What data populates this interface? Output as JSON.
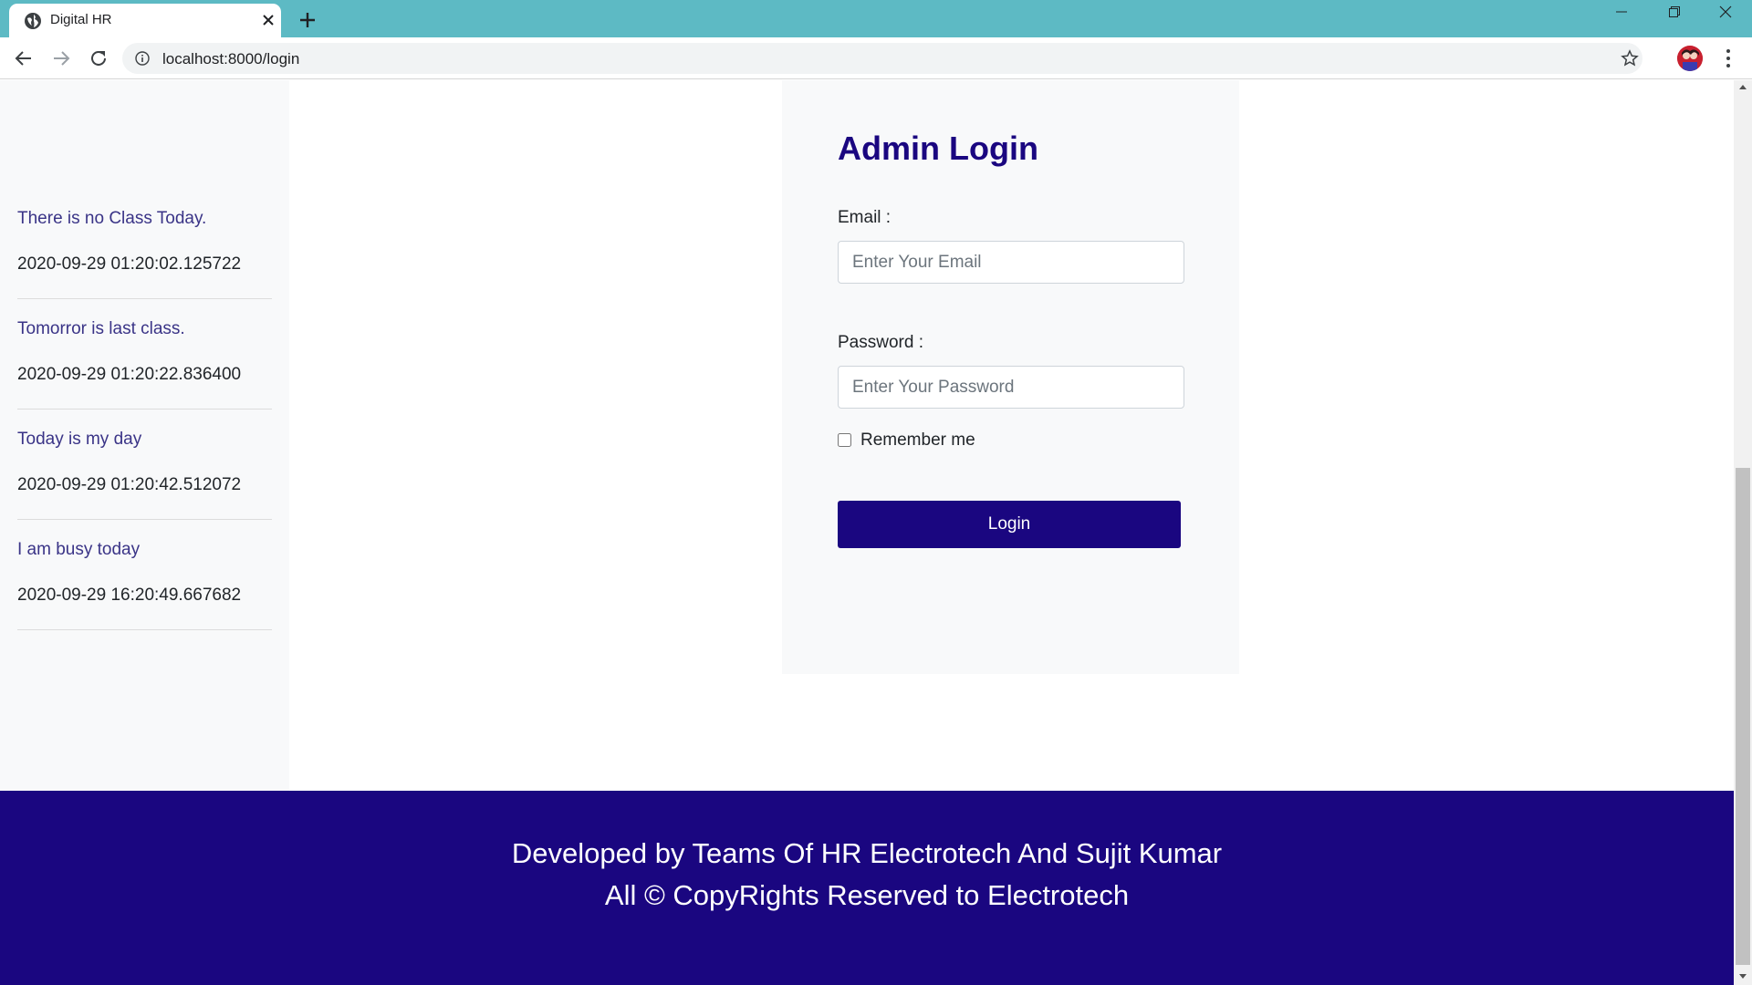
{
  "browser": {
    "tab_title": "Digital HR",
    "url": "localhost:8000/login",
    "icons": [
      "globe-icon",
      "close-icon",
      "plus-icon",
      "minimize-icon",
      "maximize-icon",
      "window-close-icon",
      "back-icon",
      "forward-icon",
      "reload-icon",
      "info-icon",
      "star-icon",
      "avatar",
      "menu-icon"
    ]
  },
  "sidebar": {
    "notices": [
      {
        "title": "There is no Class Today.",
        "date": "2020-09-29 01:20:02.125722"
      },
      {
        "title": "Tomorror is last class.",
        "date": "2020-09-29 01:20:22.836400"
      },
      {
        "title": "Today is my day",
        "date": "2020-09-29 01:20:42.512072"
      },
      {
        "title": "I am busy today",
        "date": "2020-09-29 16:20:49.667682"
      }
    ]
  },
  "login": {
    "heading": "Admin Login",
    "email_label": "Email :",
    "email_placeholder": "Enter Your Email",
    "password_label": "Password :",
    "password_placeholder": "Enter Your Password",
    "remember_label": "Remember me",
    "button_label": "Login"
  },
  "footer": {
    "line1": "Developed by Teams Of HR Electrotech And Sujit Kumar",
    "line2": "All © CopyRights Reserved to Electrotech"
  },
  "colors": {
    "tabstrip": "#5dbac4",
    "brand": "#1a0680",
    "notice_title": "#3a3487"
  }
}
